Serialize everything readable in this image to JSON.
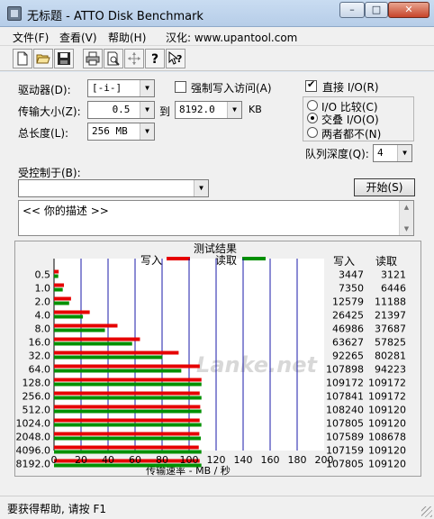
{
  "window": {
    "title": "无标题 - ATTO Disk Benchmark",
    "min_label": "–",
    "max_label": "□",
    "close_label": "✕"
  },
  "menu": {
    "file": "文件(F)",
    "view": "查看(V)",
    "help": "帮助(H)",
    "localize": "汉化: www.upantool.com"
  },
  "toolbar": {
    "icons": [
      "new-file-icon",
      "open-folder-icon",
      "save-icon",
      "print-icon",
      "print-preview-icon",
      "move-icon",
      "help-icon",
      "context-help-icon"
    ]
  },
  "settings": {
    "drive_label": "驱动器(D):",
    "drive_value": "[-i-]",
    "force_write_label": "强制写入访问(A)",
    "force_write_checked": false,
    "transfer_size_label": "传输大小(Z):",
    "transfer_from": "0.5",
    "to_label": "到",
    "transfer_to": "8192.0",
    "kb_label": "KB",
    "total_length_label": "总长度(L):",
    "total_length_value": "256 MB",
    "direct_io_label": "直接 I/O(R)",
    "direct_io_checked": true,
    "io_options": [
      {
        "label": "I/O 比较(C)",
        "selected": false
      },
      {
        "label": "交叠 I/O(O)",
        "selected": true
      },
      {
        "label": "两者都不(N)",
        "selected": false
      }
    ],
    "queue_depth_label": "队列深度(Q):",
    "queue_depth_value": "4",
    "controlled_by_label": "受控制于(B):",
    "controlled_by_value": "",
    "start_button": "开始(S)",
    "description": "<<  你的描述  >>"
  },
  "results": {
    "title": "测试结果",
    "legend_write": "写入",
    "legend_read": "读取",
    "col_write": "写入",
    "col_read": "读取",
    "watermark": "Lanke.net",
    "colors": {
      "write": "#e60000",
      "read": "#009000",
      "grid": "#1a1aa8"
    }
  },
  "chart_data": {
    "type": "bar",
    "orientation": "horizontal",
    "title": "测试结果",
    "xlabel": "传输速率 - MB / 秒",
    "ylabel": "",
    "xlim": [
      0,
      200
    ],
    "xticks": [
      0,
      20,
      40,
      60,
      80,
      100,
      120,
      140,
      160,
      180,
      200
    ],
    "categories": [
      "0.5",
      "1.0",
      "2.0",
      "4.0",
      "8.0",
      "16.0",
      "32.0",
      "64.0",
      "128.0",
      "256.0",
      "512.0",
      "1024.0",
      "2048.0",
      "4096.0",
      "8192.0"
    ],
    "series": [
      {
        "name": "写入",
        "color": "#e60000",
        "values": [
          3447,
          7350,
          12579,
          26425,
          46986,
          63627,
          92265,
          107898,
          109172,
          107841,
          108240,
          107805,
          107589,
          107159,
          107805
        ]
      },
      {
        "name": "读取",
        "color": "#009000",
        "values": [
          3121,
          6446,
          11188,
          21397,
          37687,
          57825,
          80281,
          94223,
          109172,
          109172,
          109120,
          109120,
          108678,
          109120,
          109120
        ]
      }
    ]
  },
  "status": {
    "text": "要获得帮助, 请按 F1"
  }
}
